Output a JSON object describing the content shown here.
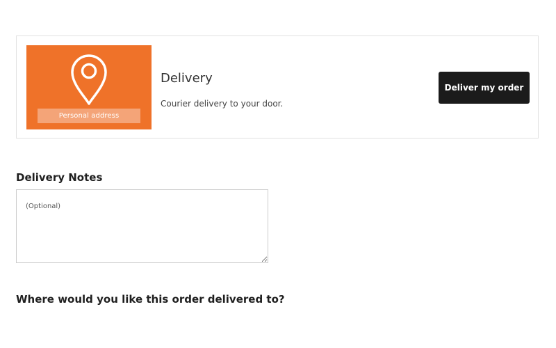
{
  "delivery_option": {
    "image_caption": "Personal address",
    "image_icon": "map-pin-icon",
    "image_color": "#ef7229",
    "title": "Delivery",
    "description": "Courier delivery to your door.",
    "button_label": "Deliver my order",
    "button_color": "#1b1b1b"
  },
  "notes": {
    "heading": "Delivery Notes",
    "placeholder": "(Optional)",
    "value": ""
  },
  "address_question": "Where would you like this order delivered to?"
}
